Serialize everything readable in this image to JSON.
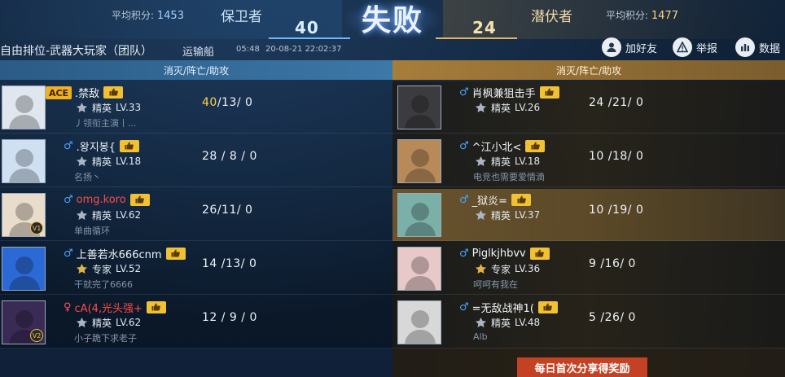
{
  "header": {
    "left_avg_label": "平均积分:",
    "left_avg_value": "1453",
    "left_team": "保卫者",
    "left_score": "40",
    "result": "失败",
    "right_score": "24",
    "right_team": "潜伏者",
    "right_avg_label": "平均积分:",
    "right_avg_value": "1477"
  },
  "match": {
    "mode": "自由排位-武器大玩家（团队）",
    "map": "运输船",
    "duration": "05:48",
    "timestamp": "20-08-21 22:02:37"
  },
  "actions": {
    "add_friend": "加好友",
    "report": "举报",
    "data": "数据"
  },
  "columns": {
    "left": "消灭/阵亡/助攻",
    "right": "消灭/阵亡/助攻"
  },
  "left_players": [
    {
      "name": ".禁敌",
      "rank": "精英",
      "level": "LV.33",
      "signature": "丿领衔主演丨...",
      "kda": "40/13/  0",
      "k": "40",
      "rest": "/13/  0",
      "ace": "ACE",
      "sex": "",
      "avatar_color": "#dfe6ee"
    },
    {
      "name": ".왕지봉{",
      "rank": "精英",
      "level": "LV.18",
      "signature": "名扬丶",
      "kda": "28 / 8 /  0",
      "sex": "♂",
      "avatar_color": "#cfe0f2"
    },
    {
      "name": "omg.koro",
      "rank": "精英",
      "level": "LV.62",
      "signature": "单曲循环",
      "kda": "26/11/  0",
      "sex": "♂",
      "red": true,
      "badge": "V1",
      "avatar_color": "#e8dccb"
    },
    {
      "name": "上善若水666cnm",
      "rank": "专家",
      "level": "LV.52",
      "signature": "干就完了6666",
      "kda": "14 /13/  0",
      "sex": "♂",
      "avatar_color": "#2b6ad6"
    },
    {
      "name": "cA(4,光头强+",
      "rank": "精英",
      "level": "LV.62",
      "signature": "小子跪下求老子",
      "kda": "12 / 9 /  0",
      "sex": "♀",
      "red": true,
      "badge": "V2",
      "avatar_color": "#3a2b55"
    }
  ],
  "right_players": [
    {
      "name": "肖枫兼狙击手",
      "rank": "精英",
      "level": "LV.26",
      "signature": "",
      "kda": "24 /21/  0",
      "sex": "♂",
      "avatar_color": "#3c3c40"
    },
    {
      "name": "^江小北<",
      "rank": "精英",
      "level": "LV.18",
      "signature": "电竞也需要爱情滴",
      "kda": "10 /18/  0",
      "sex": "♂",
      "avatar_color": "#b88a5a"
    },
    {
      "name": "_狱炎=",
      "rank": "精英",
      "level": "LV.37",
      "signature": "",
      "kda": "10 /19/  0",
      "sex": "♂",
      "highlight": true,
      "avatar_color": "#7bb0a8"
    },
    {
      "name": "Piglkjhbvv",
      "rank": "专家",
      "level": "LV.36",
      "signature": "呵呵有我在",
      "kda": "9  /16/  0",
      "sex": "♂",
      "avatar_color": "#e8c8c8"
    },
    {
      "name": "=无敌战神1(",
      "rank": "精英",
      "level": "LV.48",
      "signature": "Alb",
      "kda": "5  /26/  0",
      "sex": "♂",
      "avatar_color": "#d8d8d8"
    }
  ],
  "share": {
    "label": "每日首次分享得奖励"
  },
  "colors": {
    "accent_blue": "#3c78a8",
    "accent_gold": "#a77d3a",
    "score_gold": "#ffd34a",
    "share_red": "#c54124"
  },
  "icons": {
    "like": "thumbs-up-icon",
    "add_friend": "person-icon",
    "report": "warning-icon",
    "data": "bar-chart-icon",
    "rank": "rank-emblem-icon"
  }
}
